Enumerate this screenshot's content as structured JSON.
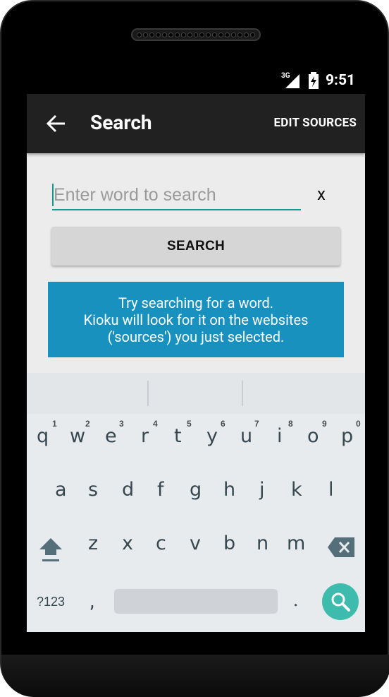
{
  "status_bar": {
    "network": "3G",
    "time": "9:51"
  },
  "app_bar": {
    "title": "Search",
    "edit_sources_label": "EDIT SOURCES",
    "back_icon": "arrow-left-icon"
  },
  "search": {
    "input_value": "",
    "placeholder": "Enter word to search",
    "clear_label": "x",
    "button_label": "SEARCH"
  },
  "info": {
    "lines": [
      "Try searching for a word.",
      "Kioku will look for it on the websites",
      "('sources') you just selected."
    ]
  },
  "keyboard": {
    "row1": [
      {
        "key": "q",
        "hint": "1"
      },
      {
        "key": "w",
        "hint": "2"
      },
      {
        "key": "e",
        "hint": "3"
      },
      {
        "key": "r",
        "hint": "4"
      },
      {
        "key": "t",
        "hint": "5"
      },
      {
        "key": "y",
        "hint": "6"
      },
      {
        "key": "u",
        "hint": "7"
      },
      {
        "key": "i",
        "hint": "8"
      },
      {
        "key": "o",
        "hint": "9"
      },
      {
        "key": "p",
        "hint": "0"
      }
    ],
    "row2": [
      "a",
      "s",
      "d",
      "f",
      "g",
      "h",
      "j",
      "k",
      "l"
    ],
    "row3": [
      "z",
      "x",
      "c",
      "v",
      "b",
      "n",
      "m"
    ],
    "symbols_label": "?123",
    "comma": ",",
    "period": ".",
    "icons": [
      "shift-icon",
      "backspace-icon",
      "search-icon"
    ]
  },
  "colors": {
    "accent": "#14998a",
    "info_bg": "#1891bf",
    "app_bar": "#212121",
    "search_key": "#3dbcae"
  }
}
